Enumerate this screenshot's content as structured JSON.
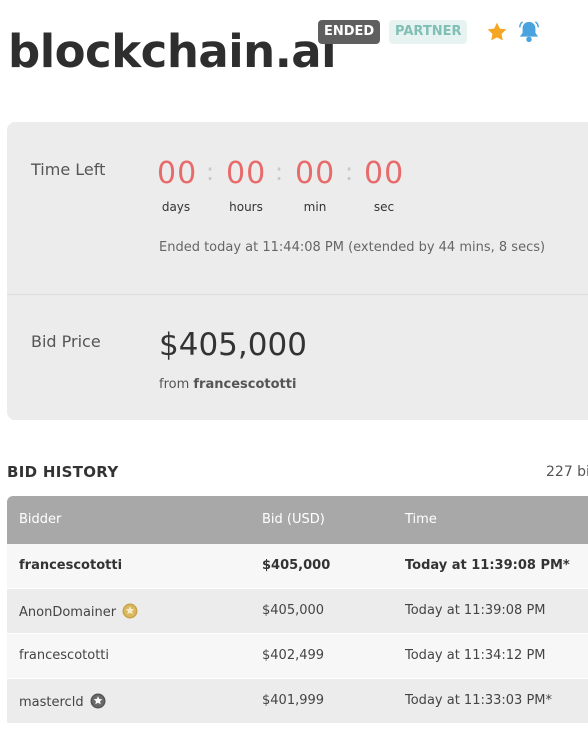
{
  "header": {
    "domain": "blockchain.ai",
    "status_badge": "ENDED",
    "partner_badge": "PARTNER",
    "star_icon": "star-icon",
    "bell_icon": "bell-icon",
    "accent_star": "#f5a623",
    "accent_bell": "#4aa3df"
  },
  "countdown": {
    "label": "Time Left",
    "days": "00",
    "hours": "00",
    "min": "00",
    "sec": "00",
    "days_label": "days",
    "hours_label": "hours",
    "min_label": "min",
    "sec_label": "sec",
    "separator": ":",
    "ended_note": "Ended today at 11:44:08 PM (extended by 44 mins, 8 secs)"
  },
  "bid": {
    "label": "Bid Price",
    "price": "$405,000",
    "from_prefix": "from",
    "from_user": "francescototti"
  },
  "history": {
    "title": "BID HISTORY",
    "count": "227 bi",
    "columns": [
      "Bidder",
      "Bid (USD)",
      "Time"
    ],
    "rows": [
      {
        "bidder": "francescototti",
        "bid": "$405,000",
        "time": "Today at 11:39:08 PM*",
        "badge": null,
        "bold": true
      },
      {
        "bidder": "AnonDomainer",
        "bid": "$405,000",
        "time": "Today at 11:39:08 PM",
        "badge": "gold-star-badge-icon",
        "bold": false
      },
      {
        "bidder": "francescototti",
        "bid": "$402,499",
        "time": "Today at 11:34:12 PM",
        "badge": null,
        "bold": false
      },
      {
        "bidder": "mastercld",
        "bid": "$401,999",
        "time": "Today at 11:33:03 PM*",
        "badge": "dark-star-badge-icon",
        "bold": false
      }
    ]
  }
}
